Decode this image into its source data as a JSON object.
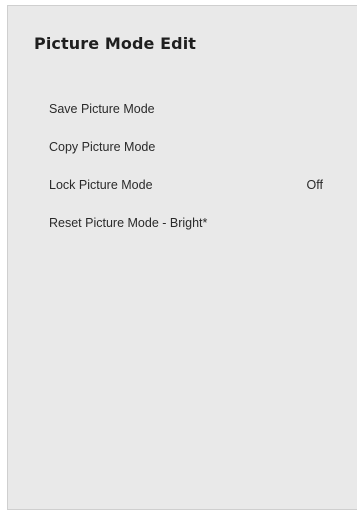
{
  "title": "Picture Mode Edit",
  "menu": {
    "items": [
      {
        "label": "Save Picture Mode"
      },
      {
        "label": "Copy Picture Mode"
      },
      {
        "label": "Lock Picture Mode",
        "value": "Off"
      },
      {
        "label": "Reset Picture Mode - Bright*"
      }
    ]
  }
}
